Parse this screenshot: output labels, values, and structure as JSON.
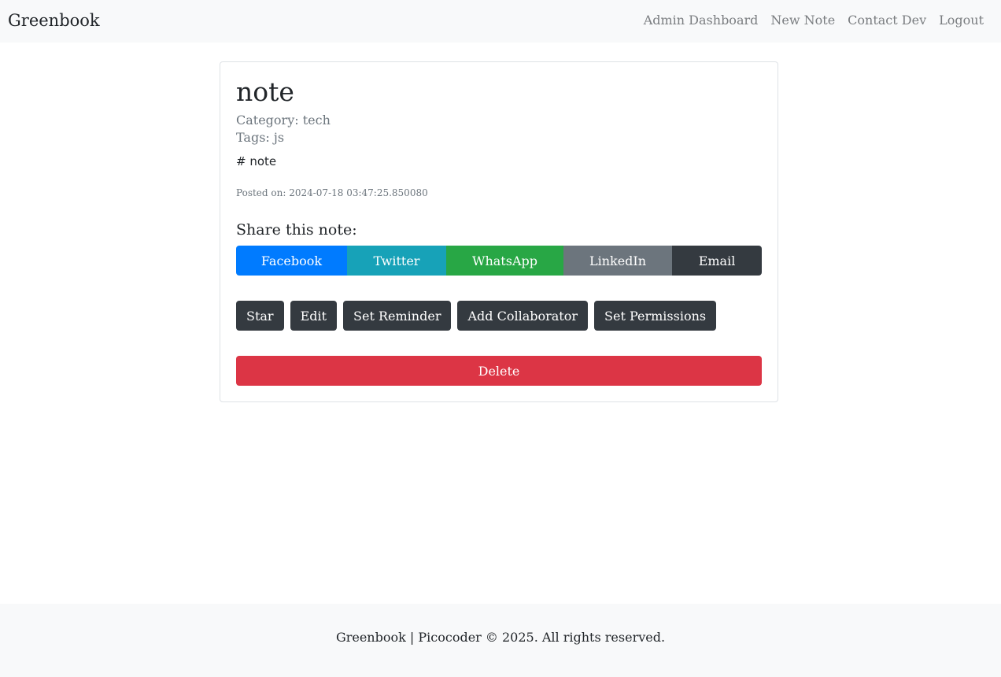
{
  "navbar": {
    "brand": "Greenbook",
    "links": [
      {
        "label": "Admin Dashboard"
      },
      {
        "label": "New Note"
      },
      {
        "label": "Contact Dev"
      },
      {
        "label": "Logout"
      }
    ]
  },
  "note": {
    "title": "note",
    "category": "Category: tech",
    "tags": "Tags: js",
    "content": "# note",
    "posted_on": "Posted on: 2024-07-18 03:47:25.850080"
  },
  "share": {
    "heading": "Share this note:",
    "buttons": [
      {
        "label": "Facebook",
        "color": "#007bff"
      },
      {
        "label": "Twitter",
        "color": "#17a2b8"
      },
      {
        "label": "WhatsApp",
        "color": "#28a745"
      },
      {
        "label": "LinkedIn",
        "color": "#6c757d"
      },
      {
        "label": "Email",
        "color": "#343a40"
      }
    ]
  },
  "actions": [
    {
      "label": "Star"
    },
    {
      "label": "Edit"
    },
    {
      "label": "Set Reminder"
    },
    {
      "label": "Add Collaborator"
    },
    {
      "label": "Set Permissions"
    }
  ],
  "delete": {
    "label": "Delete",
    "color": "#dc3545"
  },
  "footer": {
    "text": "Greenbook | Picocoder © 2025. All rights reserved."
  }
}
